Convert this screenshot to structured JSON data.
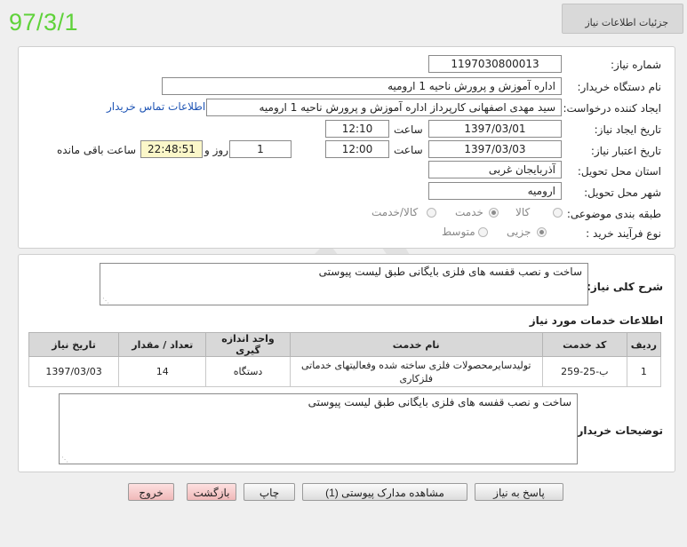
{
  "date_stamp": "97/3/1",
  "header": {
    "title": "جزئیات اطلاعات نیاز"
  },
  "form": {
    "need_number": {
      "label": "شماره نیاز:",
      "value": "1197030800013"
    },
    "buyer_org": {
      "label": "نام دستگاه خریدار:",
      "value": "اداره آموزش و پرورش ناحیه 1 ارومیه"
    },
    "requester": {
      "label": "ایجاد کننده درخواست:",
      "value": "سید مهدی اصفهانی کارپرداز اداره آموزش و پرورش ناحیه 1 ارومیه",
      "link": "اطلاعات تماس خریدار"
    },
    "created": {
      "label": "تاریخ ایجاد نیاز:",
      "date": "1397/03/01",
      "time_label": "ساعت",
      "time": "12:10"
    },
    "valid_until": {
      "label": "تاریخ اعتبار نیاز:",
      "date": "1397/03/03",
      "time_label": "ساعت",
      "time": "12:00",
      "days": "1",
      "days_label": "روز و",
      "remaining": "22:48:51",
      "remaining_label": "ساعت باقی مانده"
    },
    "province": {
      "label": "استان محل تحویل:",
      "value": "آذربایجان غربی"
    },
    "city": {
      "label": "شهر محل تحویل:",
      "value": "ارومیه"
    },
    "category": {
      "label": "طبقه بندی موضوعی:",
      "options": [
        "کالا",
        "خدمت",
        "کالا/خدمت"
      ],
      "selected": "خدمت"
    },
    "process": {
      "label": "نوع فرآیند خرید :",
      "options": [
        "جزیی",
        "متوسط"
      ],
      "selected": "جزیی"
    }
  },
  "summary": {
    "label": "شرح کلی نیاز:",
    "text": "ساخت و نصب قفسه های فلزی بایگانی طبق لیست پیوستی"
  },
  "services": {
    "title": "اطلاعات خدمات مورد نیاز",
    "columns": [
      "ردیف",
      "کد خدمت",
      "نام خدمت",
      "واحد اندازه گیری",
      "تعداد / مقدار",
      "تاریخ نیاز"
    ],
    "rows": [
      {
        "row": "1",
        "code": "ب-25-259",
        "name": "تولیدسایرمحصولات فلزی ساخته شده وفعالیتهای خدماتی فلزکاری",
        "unit": "دستگاه",
        "qty": "14",
        "date": "1397/03/03"
      }
    ]
  },
  "buyer_notes": {
    "label": "توضیحات خریدار:",
    "text": "ساخت و نصب قفسه های فلزی بایگانی طبق لیست پیوستی"
  },
  "buttons": {
    "reply": "پاسخ به نیاز",
    "attachments": "مشاهده مدارک پیوستی (1)",
    "print": "چاپ",
    "back": "بازگشت",
    "exit": "خروج"
  },
  "colors": {
    "date_stamp": "#5fd23a",
    "link": "#1f55b5",
    "remaining_bg": "#fbf7c9",
    "exit_bg": "#f0b9b9"
  }
}
